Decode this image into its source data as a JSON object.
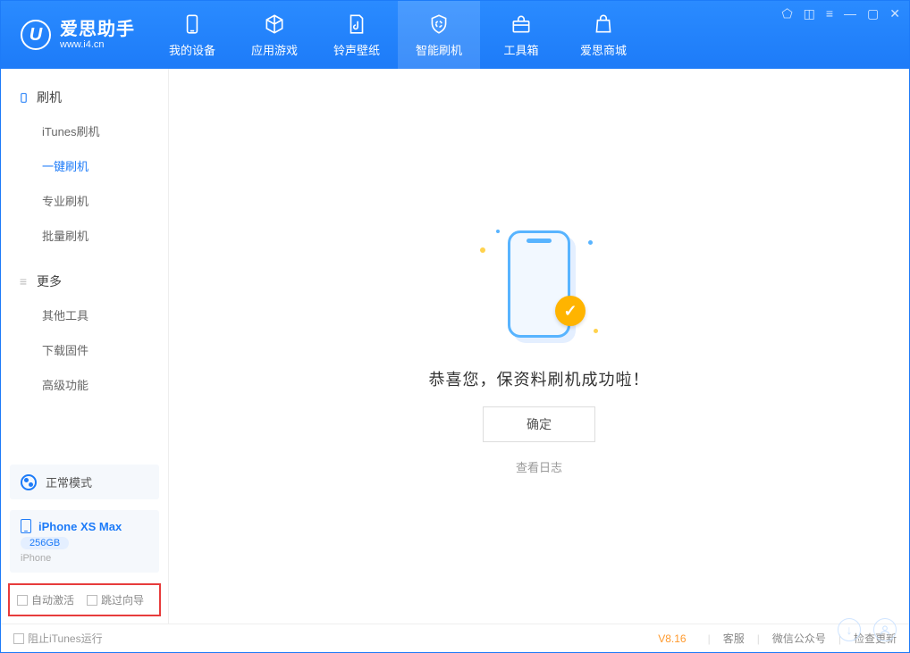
{
  "brand": {
    "title": "爱思助手",
    "url": "www.i4.cn",
    "logo_letter": "U"
  },
  "tabs": {
    "device": "我的设备",
    "apps": "应用游戏",
    "ring": "铃声壁纸",
    "flash": "智能刷机",
    "tools": "工具箱",
    "store": "爱思商城"
  },
  "sidebar": {
    "group_flash": "刷机",
    "items_flash": {
      "itunes": "iTunes刷机",
      "onekey": "一键刷机",
      "pro": "专业刷机",
      "batch": "批量刷机"
    },
    "group_more": "更多",
    "items_more": {
      "other": "其他工具",
      "fw": "下载固件",
      "adv": "高级功能"
    }
  },
  "mode": {
    "label": "正常模式"
  },
  "device": {
    "name": "iPhone XS Max",
    "capacity": "256GB",
    "type": "iPhone"
  },
  "options": {
    "auto_activate": "自动激活",
    "skip_guide": "跳过向导"
  },
  "main": {
    "success": "恭喜您，保资料刷机成功啦！",
    "ok": "确定",
    "view_log": "查看日志"
  },
  "footer": {
    "block_itunes": "阻止iTunes运行",
    "version": "V8.16",
    "support": "客服",
    "wechat": "微信公众号",
    "update": "检查更新"
  },
  "winctrl": {
    "pin": "⬠",
    "skin": "◫",
    "menu": "≡",
    "min": "—",
    "max": "▢",
    "close": "✕"
  }
}
